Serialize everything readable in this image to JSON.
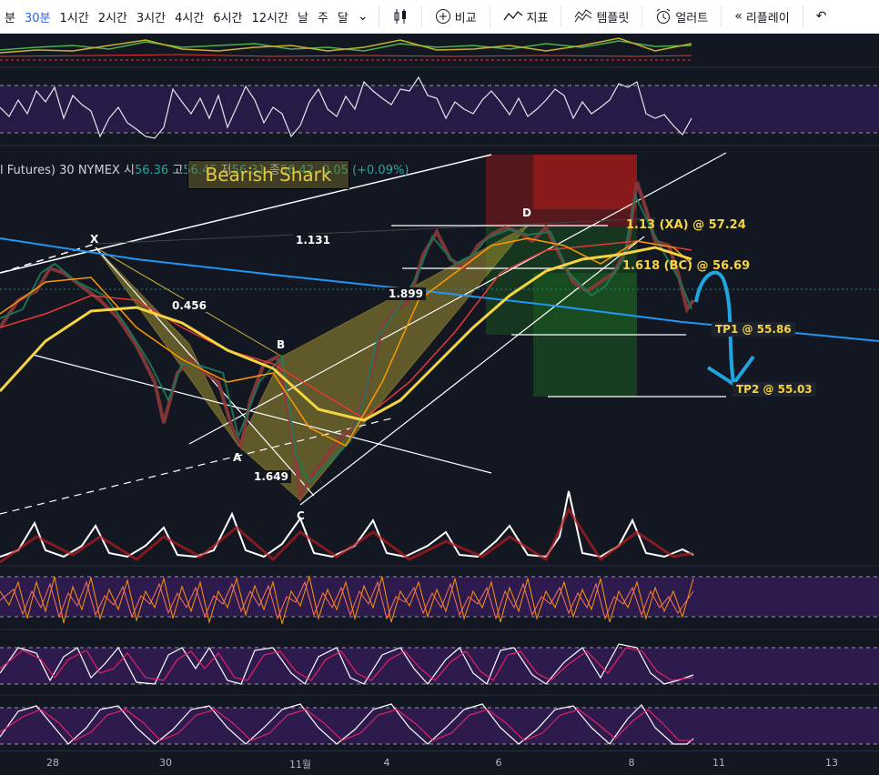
{
  "toolbar": {
    "timeframes": [
      "분",
      "30분",
      "1시간",
      "2시간",
      "3시간",
      "4시간",
      "6시간",
      "12시간",
      "날",
      "주",
      "달"
    ],
    "active_timeframe": "30분",
    "compare_label": "비교",
    "indicators_label": "지표",
    "templates_label": "템플릿",
    "alert_label": "얼러트",
    "replay_label": "리플레이"
  },
  "legend": {
    "symbol": "l Futures)",
    "interval": "30",
    "exchange": "NYMEX",
    "open_label": "시",
    "open": "56.36",
    "high_label": "고",
    "high": "56.45",
    "low_label": "저",
    "low": "56.31",
    "close_label": "종",
    "close": "56.42",
    "change": "-0.05 (+0.09%)"
  },
  "pattern": {
    "title": "Bearish Shark",
    "point_x": "X",
    "point_a": "A",
    "point_b": "B",
    "point_c": "C",
    "point_d": "D",
    "ratio_xb": "0.456",
    "ratio_ac": "1.649",
    "ratio_bd": "1.899",
    "ratio_xc": "1.131"
  },
  "annotations": {
    "xa_level": "1.13 (XA) @ 57.24",
    "bc_level": "1.618 (BC) @ 56.69",
    "tp1": "TP1 @ 55.86",
    "tp2": "TP2 @ 55.03"
  },
  "xaxis": {
    "labels": [
      "28",
      "30",
      "11월",
      "4",
      "6",
      "8",
      "11",
      "13"
    ]
  },
  "colors": {
    "background": "#131722",
    "up": "#26a69a",
    "down": "#ef5350",
    "pattern_fill": "#a09030",
    "trend_blue": "#2196f3",
    "ma_yellow": "#f5d442",
    "ma_orange": "#ff9800",
    "ma_red": "#e53935",
    "oscillator_band": "#2d1b4e",
    "annotation_blue": "#1fa5e0"
  },
  "icons": [
    "chevron-down-icon",
    "candles-icon",
    "plus-circle-icon",
    "indicators-icon",
    "templates-icon",
    "alarm-icon",
    "replay-icon",
    "undo-icon"
  ]
}
